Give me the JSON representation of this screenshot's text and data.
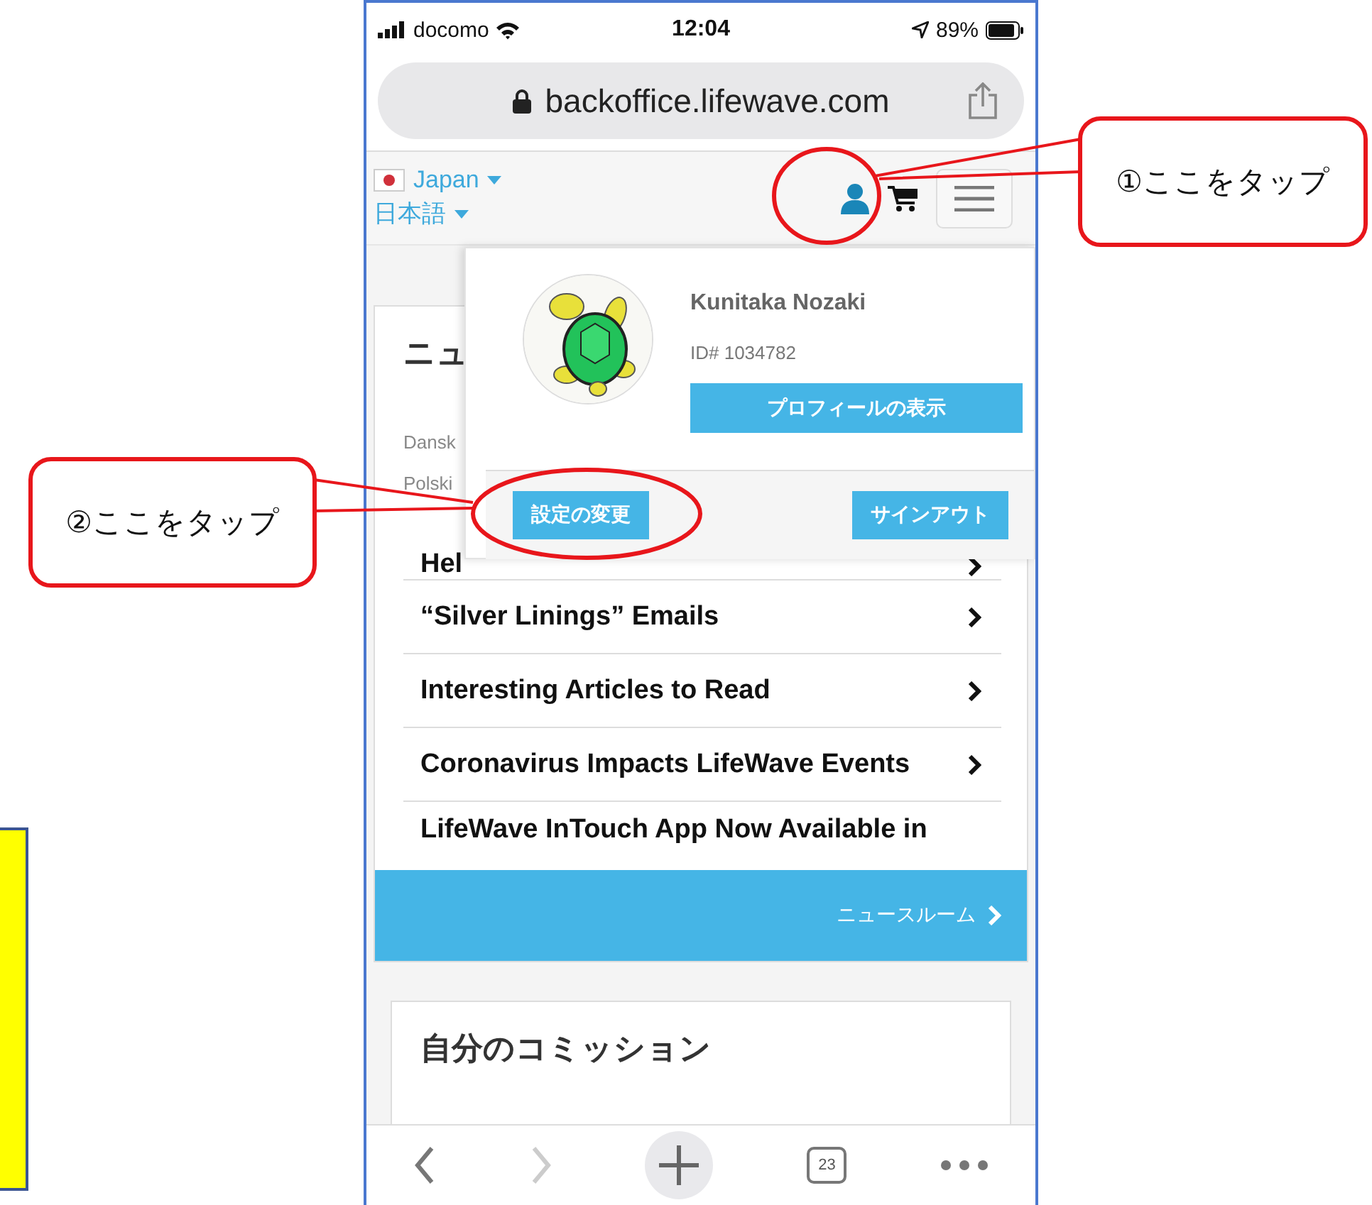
{
  "status_bar": {
    "carrier": "docomo",
    "time": "12:04",
    "battery": "89%"
  },
  "address_bar": {
    "url": "backoffice.lifewave.com"
  },
  "header": {
    "country": "Japan",
    "language": "日本語"
  },
  "news_card": {
    "title": "ニュ",
    "languages": [
      "Dansk",
      "Polski"
    ],
    "articles": [
      {
        "title": "Hel",
        "has_arrow": true
      },
      {
        "title": "“Silver Linings” Emails",
        "has_arrow": true
      },
      {
        "title": "Interesting Articles to Read",
        "has_arrow": true
      },
      {
        "title": "Coronavirus Impacts LifeWave Events",
        "has_arrow": true
      },
      {
        "title": "LifeWave InTouch App Now Available in",
        "has_arrow": false
      }
    ],
    "footer_link": "ニュースルーム"
  },
  "commission_card": {
    "title": "自分のコミッション"
  },
  "toolbar": {
    "tab_count": "23",
    "forward_disabled": true
  },
  "profile_menu": {
    "name": "Kunitaka Nozaki",
    "member_id": "ID# 1034782",
    "profile_button": "プロフィールの表示",
    "settings_button": "設定の変更",
    "signout_button": "サインアウト"
  },
  "callouts": [
    {
      "text": "①ここをタップ"
    },
    {
      "text": "②ここをタップ"
    }
  ]
}
